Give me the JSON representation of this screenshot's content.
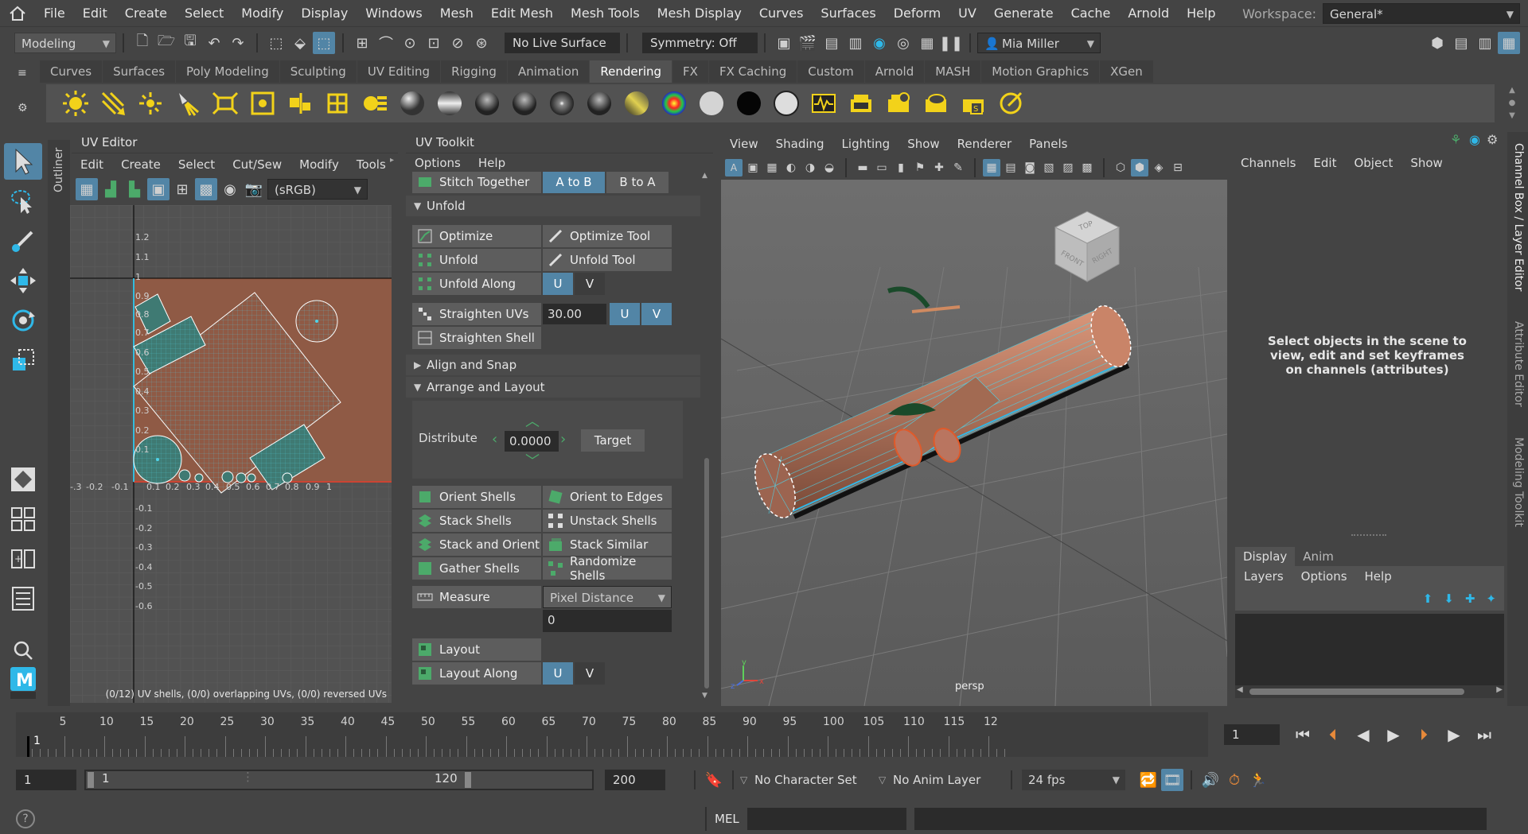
{
  "menubar": {
    "items": [
      "File",
      "Edit",
      "Create",
      "Select",
      "Modify",
      "Display",
      "Windows",
      "Mesh",
      "Edit Mesh",
      "Mesh Tools",
      "Mesh Display",
      "Curves",
      "Surfaces",
      "Deform",
      "UV",
      "Generate",
      "Cache",
      "Arnold",
      "Help"
    ],
    "workspace_label": "Workspace:",
    "workspace_value": "General*"
  },
  "statusline": {
    "mode": "Modeling",
    "live_surface": "No Live Surface",
    "symmetry": "Symmetry: Off",
    "user": "Mia Miller"
  },
  "shelf": {
    "tabs": [
      "Curves",
      "Surfaces",
      "Poly Modeling",
      "Sculpting",
      "UV Editing",
      "Rigging",
      "Animation",
      "Rendering",
      "FX",
      "FX Caching",
      "Custom",
      "Arnold",
      "MASH",
      "Motion Graphics",
      "XGen"
    ],
    "active_tab": "Rendering"
  },
  "outliner": {
    "label": "Outliner"
  },
  "uv_editor": {
    "title": "UV Editor",
    "menus": [
      "Edit",
      "Create",
      "Select",
      "Cut/Sew",
      "Modify",
      "Tools"
    ],
    "colorspace": "(sRGB)",
    "status": "(0/12) UV shells, (0/0) overlapping UVs, (0/0) reversed UVs",
    "vticks": [
      "1.2",
      "1.1",
      "1",
      "0.9",
      "0.8",
      "0.7",
      "0.6",
      "0.5",
      "0.4",
      "0.3",
      "0.2",
      "0.1",
      "-0.1",
      "-0.2",
      "-0.3",
      "-0.4",
      "-0.5",
      "-0.6"
    ],
    "hticks": [
      "-.3",
      "-0.2",
      "-0.1",
      "0.1",
      "0.2",
      "0.3",
      "0.4",
      "0.5",
      "0.6",
      "0.7",
      "0.8",
      "0.9",
      "1"
    ]
  },
  "uv_toolkit": {
    "title": "UV Toolkit",
    "menus": [
      "Options",
      "Help"
    ],
    "stitch": {
      "label": "Stitch Together",
      "a_to_b": "A to B",
      "b_to_a": "B to A"
    },
    "unfold_section": "Unfold",
    "optimize": "Optimize",
    "optimize_tool": "Optimize Tool",
    "unfold": "Unfold",
    "unfold_tool": "Unfold Tool",
    "unfold_along": "Unfold Along",
    "u": "U",
    "v": "V",
    "straighten_uvs": "Straighten UVs",
    "straighten_value": "30.00",
    "straighten_shell": "Straighten Shell",
    "align_section": "Align and Snap",
    "arrange_section": "Arrange and Layout",
    "distribute": "Distribute",
    "distribute_value": "0.0000",
    "target": "Target",
    "orient_shells": "Orient Shells",
    "orient_edges": "Orient to Edges",
    "stack_shells": "Stack Shells",
    "unstack_shells": "Unstack Shells",
    "stack_orient": "Stack and Orient",
    "stack_similar": "Stack Similar",
    "gather_shells": "Gather Shells",
    "randomize_shells": "Randomize Shells",
    "measure": "Measure",
    "measure_mode": "Pixel Distance",
    "measure_value": "0",
    "layout": "Layout",
    "layout_along": "Layout Along"
  },
  "viewport": {
    "menus": [
      "View",
      "Shading",
      "Lighting",
      "Show",
      "Renderer",
      "Panels"
    ],
    "camera": "persp",
    "cube": {
      "top": "TOP",
      "front": "FRONT",
      "right": "RIGHT"
    },
    "axes": {
      "x": "x",
      "y": "y",
      "z": "z"
    }
  },
  "channel_box": {
    "menus": [
      "Channels",
      "Edit",
      "Object",
      "Show"
    ],
    "hint": "Select objects in the scene to view, edit and set keyframes on channels (attributes)",
    "side_tabs": [
      "Channel Box / Layer Editor",
      "Attribute Editor",
      "Modeling Toolkit"
    ]
  },
  "layer_editor": {
    "tabs": [
      "Display",
      "Anim"
    ],
    "active_tab": "Display",
    "menus": [
      "Layers",
      "Options",
      "Help"
    ]
  },
  "timeline": {
    "ticks": [
      "5",
      "10",
      "15",
      "20",
      "25",
      "30",
      "35",
      "40",
      "45",
      "50",
      "55",
      "60",
      "65",
      "70",
      "75",
      "80",
      "85",
      "90",
      "95",
      "100",
      "105",
      "110",
      "115",
      "12"
    ],
    "current_frame_marker": "1",
    "current_frame": "1"
  },
  "range": {
    "start": "1",
    "range_start": "1",
    "range_end": "120",
    "end": "200",
    "character_set": "No Character Set",
    "anim_layer": "No Anim Layer",
    "fps": "24 fps"
  },
  "cmdline": {
    "mel": "MEL"
  },
  "colors": {
    "accent": "#5285a6",
    "uv_fill": "#8f5a45",
    "uv_shell": "#3f7a73",
    "wire": "#4fd3e8"
  }
}
